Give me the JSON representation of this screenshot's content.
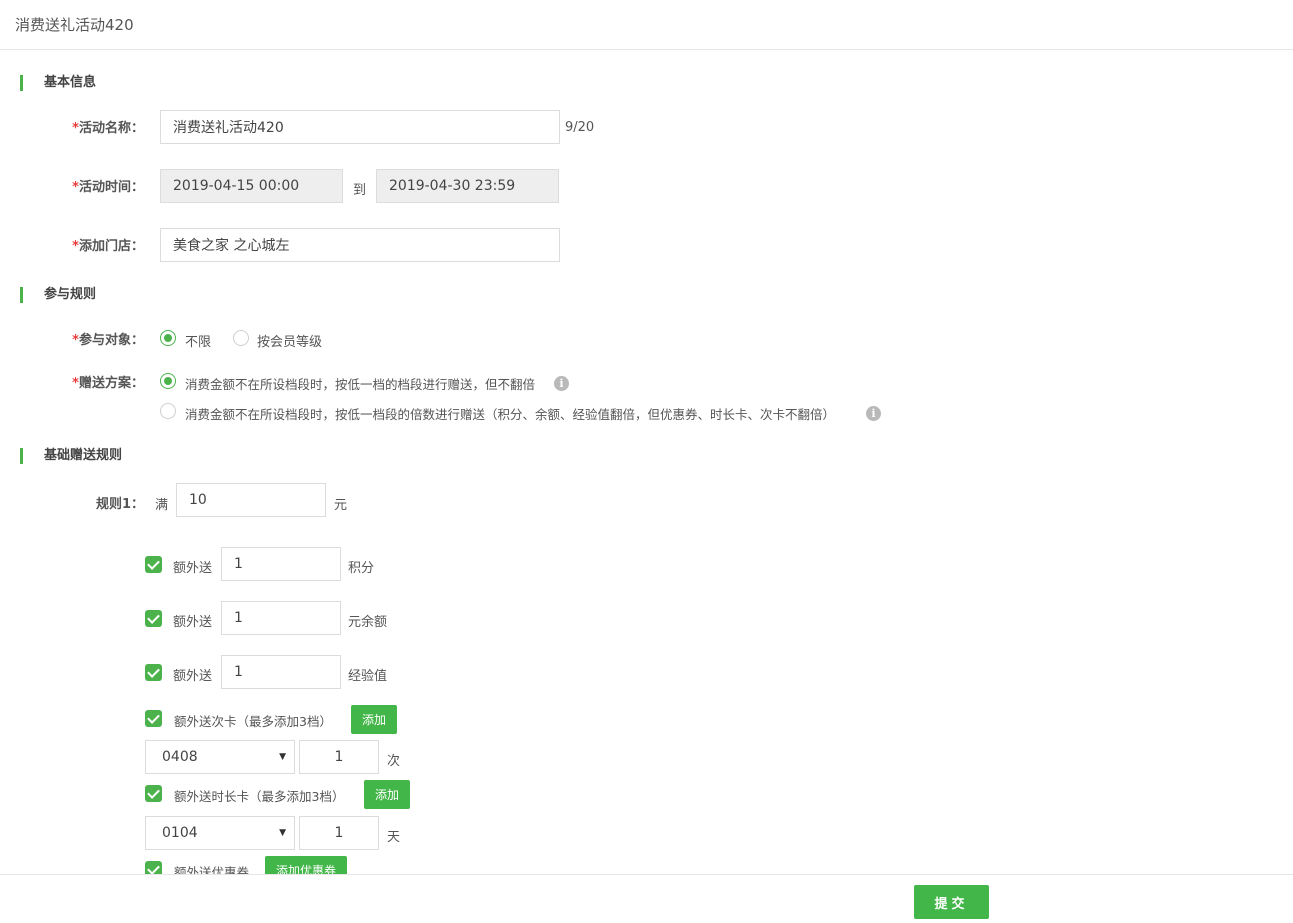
{
  "header": {
    "title": "消费送礼活动420"
  },
  "sections": {
    "basic": "基本信息",
    "rules": "参与规则",
    "gift_rules": "基础赠送规则"
  },
  "basic": {
    "name_label": "活动名称：",
    "name_value": "消费送礼活动420",
    "name_count": "9/20",
    "time_label": "活动时间：",
    "time_start": "2019-04-15 00:00",
    "time_to": "到",
    "time_end": "2019-04-30 23:59",
    "store_label": "添加门店：",
    "store_value": "美食之家 之心城左",
    "required_mark": "*"
  },
  "rules": {
    "target_label": "参与对象：",
    "target_options": [
      "不限",
      "按会员等级"
    ],
    "target_selected": "不限",
    "plan_label": "赠送方案：",
    "plan_options": [
      "消费金额不在所设档段时，按低一档的档段进行赠送，但不翻倍",
      "消费金额不在所设档段时，按低一档段的倍数进行赠送（积分、余额、经验值翻倍，但优惠券、时长卡、次卡不翻倍）"
    ],
    "plan_selected": 0,
    "info_icon": "i"
  },
  "gift": {
    "rule_label": "规则1：",
    "rule_prefix": "满",
    "rule_amount": "10",
    "rule_unit": "元",
    "extras": [
      {
        "label": "额外送",
        "value": "1",
        "unit": "积分",
        "checked": true
      },
      {
        "label": "额外送",
        "value": "1",
        "unit": "元余额",
        "checked": true
      },
      {
        "label": "额外送",
        "value": "1",
        "unit": "经验值",
        "checked": true
      }
    ],
    "times_card": {
      "label": "额外送次卡（最多添加3档）",
      "add": "添加",
      "select": "0408",
      "count": "1",
      "unit": "次",
      "checked": true
    },
    "duration_card": {
      "label": "额外送时长卡（最多添加3档）",
      "add": "添加",
      "select": "0104",
      "count": "1",
      "unit": "天",
      "checked": true
    },
    "coupon": {
      "label": "额外送优惠券",
      "add": "添加优惠券",
      "checked": true
    }
  },
  "footer": {
    "submit": "提交"
  },
  "colors": {
    "accent": "#43b649",
    "required": "#e83c3c",
    "disabled_bg": "#eeeeee"
  }
}
